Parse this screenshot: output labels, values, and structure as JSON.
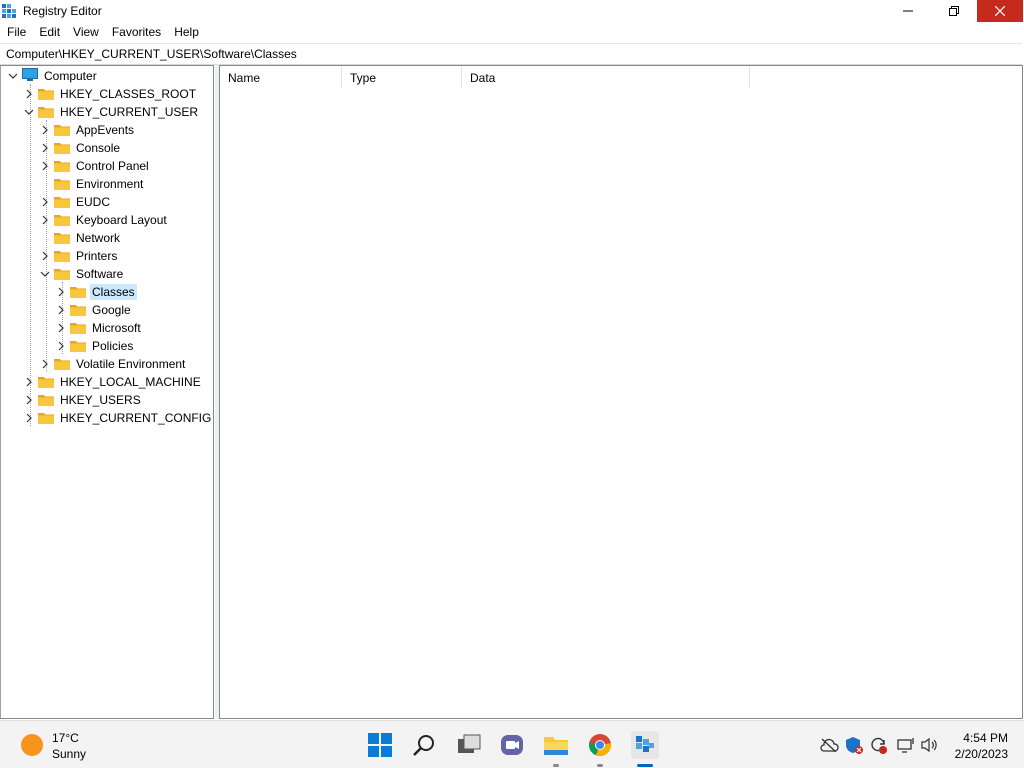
{
  "window": {
    "title": "Registry Editor"
  },
  "menu": [
    "File",
    "Edit",
    "View",
    "Favorites",
    "Help"
  ],
  "address": "Computer\\HKEY_CURRENT_USER\\Software\\Classes",
  "tree": [
    {
      "label": "Computer",
      "level": 0,
      "expanded": true,
      "icon": "computer-icon"
    },
    {
      "label": "HKEY_CLASSES_ROOT",
      "level": 1,
      "chevron": "right"
    },
    {
      "label": "HKEY_CURRENT_USER",
      "level": 1,
      "chevron": "down"
    },
    {
      "label": "AppEvents",
      "level": 2,
      "chevron": "right"
    },
    {
      "label": "Console",
      "level": 2,
      "chevron": "right"
    },
    {
      "label": "Control Panel",
      "level": 2,
      "chevron": "right"
    },
    {
      "label": "Environment",
      "level": 2,
      "chevron": "none"
    },
    {
      "label": "EUDC",
      "level": 2,
      "chevron": "right"
    },
    {
      "label": "Keyboard Layout",
      "level": 2,
      "chevron": "right"
    },
    {
      "label": "Network",
      "level": 2,
      "chevron": "none"
    },
    {
      "label": "Printers",
      "level": 2,
      "chevron": "right"
    },
    {
      "label": "Software",
      "level": 2,
      "chevron": "down"
    },
    {
      "label": "Classes",
      "level": 3,
      "chevron": "right",
      "selected": true
    },
    {
      "label": "Google",
      "level": 3,
      "chevron": "right"
    },
    {
      "label": "Microsoft",
      "level": 3,
      "chevron": "right"
    },
    {
      "label": "Policies",
      "level": 3,
      "chevron": "right"
    },
    {
      "label": "Volatile Environment",
      "level": 2,
      "chevron": "right"
    },
    {
      "label": "HKEY_LOCAL_MACHINE",
      "level": 1,
      "chevron": "right"
    },
    {
      "label": "HKEY_USERS",
      "level": 1,
      "chevron": "right"
    },
    {
      "label": "HKEY_CURRENT_CONFIG",
      "level": 1,
      "chevron": "right"
    }
  ],
  "columns": {
    "name": "Name",
    "type": "Type",
    "data": "Data"
  },
  "taskbar": {
    "weather_temp": "17°C",
    "weather_condition": "Sunny",
    "time": "4:54 PM",
    "date": "2/20/2023",
    "pinned": [
      "start-icon",
      "search-icon",
      "task-view-icon",
      "chat-icon",
      "file-explorer-icon",
      "chrome-icon",
      "registry-editor-icon"
    ]
  },
  "colors": {
    "selection": "#cce8ff",
    "close_button": "#c42b1c",
    "folder": "#f8c83a",
    "accent": "#0067c0"
  }
}
